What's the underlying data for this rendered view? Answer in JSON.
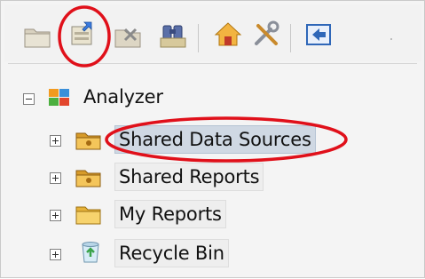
{
  "toolbar": {
    "buttons": [
      {
        "icon": "new-folder-icon"
      },
      {
        "icon": "new-data-source-icon"
      },
      {
        "icon": "delete-icon"
      },
      {
        "icon": "find-icon"
      },
      {
        "icon": "home-icon"
      },
      {
        "icon": "settings-tools-icon"
      },
      {
        "icon": "back-icon"
      }
    ]
  },
  "tree": {
    "root": {
      "label": "Analyzer",
      "icon": "analyzer-logo-icon",
      "expanded": true
    },
    "items": [
      {
        "label": "Shared Data Sources",
        "icon": "shared-folder-icon",
        "selected": true
      },
      {
        "label": "Shared Reports",
        "icon": "shared-folder-icon",
        "selected": false
      },
      {
        "label": "My Reports",
        "icon": "folder-icon",
        "selected": false
      },
      {
        "label": "Recycle Bin",
        "icon": "recycle-bin-icon",
        "selected": false
      }
    ]
  },
  "annotations": {
    "color": "#e0101a",
    "circled": [
      "new-data-source-button",
      "Shared Data Sources"
    ]
  }
}
